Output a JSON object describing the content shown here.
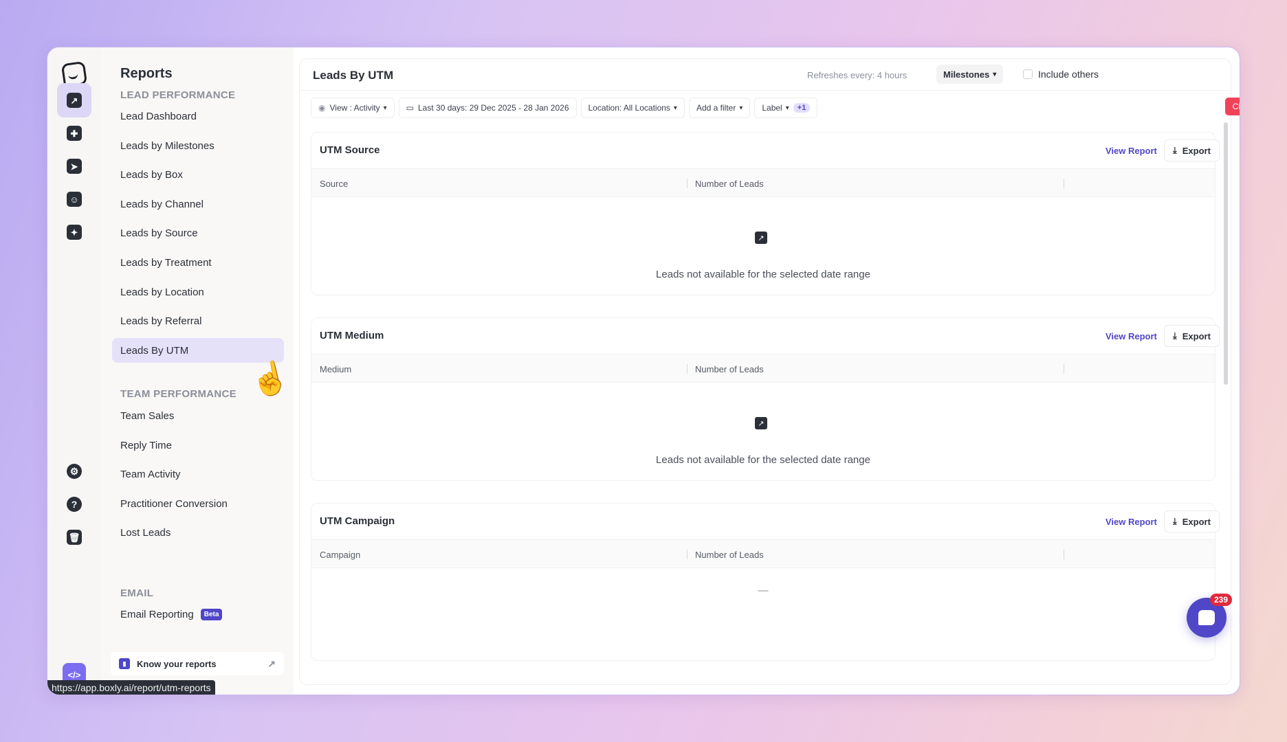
{
  "sidebar": {
    "title": "Reports",
    "sections": [
      {
        "label": "LEAD PERFORMANCE"
      },
      {
        "label": "TEAM PERFORMANCE"
      },
      {
        "label": "EMAIL"
      }
    ],
    "lead_items": [
      "Lead Dashboard",
      "Leads by Milestones",
      "Leads by Box",
      "Leads by Channel",
      "Leads by Source",
      "Leads by Treatment",
      "Leads by Location",
      "Leads by Referral",
      "Leads By UTM"
    ],
    "team_items": [
      "Team Sales",
      "Reply Time",
      "Team Activity",
      "Practitioner Conversion",
      "Lost Leads"
    ],
    "email_items": [
      {
        "label": "Email Reporting",
        "badge": "Beta"
      }
    ],
    "know_reports": "Know your reports",
    "status_url": "https://app.boxly.ai/report/utm-reports"
  },
  "header": {
    "title": "Leads By UTM",
    "refresh": "Refreshes every: 4 hours",
    "milestones": "Milestones",
    "include_others": "Include others"
  },
  "filters": {
    "view": "View : Activity",
    "date": "Last 30 days: 29 Dec 2025 - 28 Jan 2026",
    "location": "Location: All Locations",
    "add_filter": "Add a filter",
    "label": "Label",
    "label_extra": "+1",
    "clear": "Clear Filter"
  },
  "cards": [
    {
      "title": "UTM Source",
      "view_report": "View Report",
      "export": "Export",
      "col1": "Source",
      "col2": "Number of Leads",
      "empty": "Leads not available for the selected date range"
    },
    {
      "title": "UTM Medium",
      "view_report": "View Report",
      "export": "Export",
      "col1": "Medium",
      "col2": "Number of Leads",
      "empty": "Leads not available for the selected date range"
    },
    {
      "title": "UTM Campaign",
      "view_report": "View Report",
      "export": "Export",
      "col1": "Campaign",
      "col2": "Number of Leads",
      "empty": "—"
    }
  ],
  "chat": {
    "badge": "239"
  },
  "icons": [
    "logo-icon",
    "reports-icon",
    "add-widget-icon",
    "send-icon",
    "contacts-icon",
    "sparkle-icon",
    "settings-icon",
    "help-icon",
    "trash-icon",
    "code-icon"
  ]
}
